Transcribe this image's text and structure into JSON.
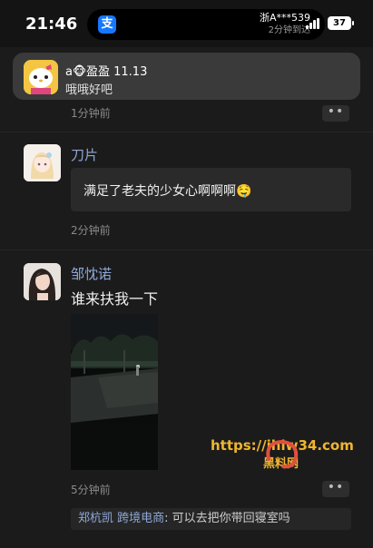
{
  "status_bar": {
    "time": "21:46",
    "island_app_icon": "支",
    "plate": "浙A***539",
    "eta": "2分钟到达",
    "battery": "37"
  },
  "banner": {
    "sender": "a🐵盈盈 11.13",
    "message": "哦哦好吧"
  },
  "feed": [
    {
      "timestamp": "1分钟前"
    },
    {
      "name": "刀片",
      "text": "满足了老夫的少女心啊啊啊🤤",
      "timestamp": "2分钟前"
    },
    {
      "name": "邹忱诺",
      "text": "谁来扶我一下",
      "timestamp": "5分钟前",
      "comment": {
        "author": "郑杭凯 跨境电商",
        "text": "可以去把你带回寝室吗"
      }
    }
  ],
  "watermark": {
    "url": "https://ihlw34.com",
    "site": "黑料网"
  },
  "more_label": "••"
}
